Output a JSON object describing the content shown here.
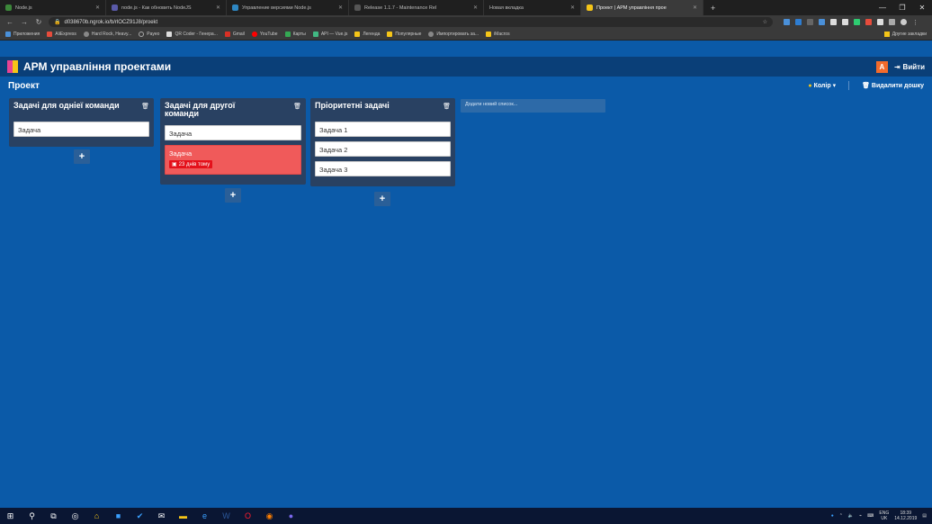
{
  "browser": {
    "tabs": [
      {
        "title": "Node.js",
        "color": "#3c873a",
        "active": false
      },
      {
        "title": "node.js - Как обновить NodeJS",
        "color": "#5a5aa8",
        "active": false
      },
      {
        "title": "Управление версиями Node.js",
        "color": "#2e86c1",
        "active": false
      },
      {
        "title": "Release 1.1.7 - Maintenance Rel",
        "color": "#555555",
        "active": false
      },
      {
        "title": "Новая вкладка",
        "color": "#1f1f1f",
        "active": false
      },
      {
        "title": "Проект | АРМ управління прое",
        "color": "#f5c518",
        "active": true
      }
    ],
    "new_tab": "+",
    "url": "d038670b.ngrok.io/b/rlOCZ91J8/proekt",
    "bookmarks": [
      "Приложения",
      "AliExpress",
      "Hard Rock, Heavy...",
      "Payeo",
      "QR Coder - Генера...",
      "Gmail",
      "YouTube",
      "Карты",
      "API — Vue.js",
      "Легенда",
      "Популярные",
      "Импортировать за...",
      "iMacros"
    ],
    "bookmarks_other": "Другие закладки"
  },
  "app": {
    "title": "АРМ управління проектами",
    "avatar_letter": "A",
    "logout_label": "Вийти"
  },
  "project": {
    "title": "Проект",
    "color_label": "Колір",
    "delete_board_label": "Видалити дошку",
    "new_list_placeholder": "Додати новий список..."
  },
  "lists": [
    {
      "title": "Задачі для одніеї команди",
      "cards": [
        {
          "text": "Задача"
        }
      ]
    },
    {
      "title": "Задачі для другої команди",
      "cards": [
        {
          "text": "Задача"
        },
        {
          "text": "Задача",
          "overdue": true,
          "due_label": "23 днів тому"
        }
      ]
    },
    {
      "title": "Пріоритетні задачі",
      "cards": [
        {
          "text": "Задача 1"
        },
        {
          "text": "Задача 2"
        },
        {
          "text": "Задача 3"
        }
      ]
    }
  ],
  "add_card_label": "+",
  "taskbar": {
    "lang": "ENG",
    "region": "UK",
    "time": "18:39",
    "date": "14.12.2019"
  },
  "colors": {
    "board_bg": "#0b5aa8",
    "header_bg": "#0a3f78",
    "list_bg": "#294162",
    "overdue_card": "#f05a5a",
    "due_badge": "#e4111b"
  }
}
